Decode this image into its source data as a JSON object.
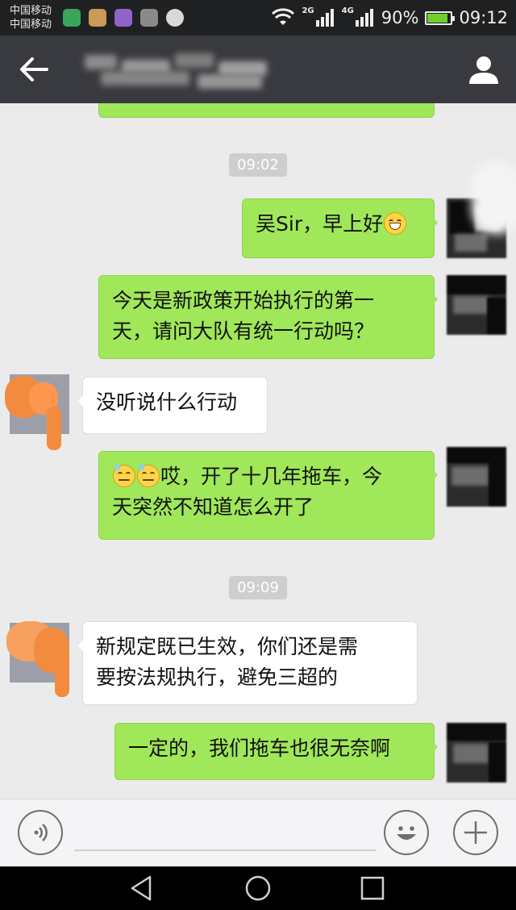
{
  "status_bar": {
    "carrier_1": "中国移动",
    "carrier_2": "中国移动",
    "net_2g": "2G",
    "net_4g": "4G",
    "battery_text": "90%",
    "battery_level": 0.9,
    "time": "09:12"
  },
  "header": {
    "back_icon": "arrow-left-icon",
    "profile_icon": "person-icon"
  },
  "messages": [
    {
      "type": "timestamp",
      "text": "09:02"
    },
    {
      "type": "bubble",
      "side": "out",
      "text": "吴Sir，早上好",
      "emoji": "grin"
    },
    {
      "type": "bubble",
      "side": "out",
      "lines": [
        "今天是新政策开始执行的第一",
        "天，请问大队有统一行动吗？"
      ]
    },
    {
      "type": "bubble",
      "side": "in",
      "text": "没听说什么行动"
    },
    {
      "type": "bubble",
      "side": "out",
      "lines": [
        "哎，开了十几年拖车，今",
        "天突然不知道怎么开了"
      ],
      "emoji_prefix": [
        "sweat",
        "sweat"
      ]
    },
    {
      "type": "timestamp",
      "text": "09:09"
    },
    {
      "type": "bubble",
      "side": "in",
      "lines": [
        "新规定既已生效，你们还是需",
        "要按法规执行，避免三超的"
      ]
    },
    {
      "type": "bubble",
      "side": "out",
      "text": "一定的，我们拖车也很无奈啊"
    }
  ],
  "input_bar": {
    "voice_icon": "voice-icon",
    "emoji_icon": "smiley-icon",
    "plus_icon": "plus-icon",
    "placeholder": ""
  },
  "colors": {
    "header_bg": "#393a3f",
    "chat_bg": "#ebebeb",
    "outgoing_bubble": "#a0e75a",
    "incoming_bubble": "#ffffff"
  }
}
